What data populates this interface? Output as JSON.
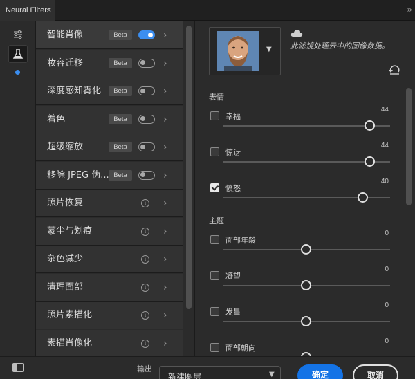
{
  "window": {
    "tab_title": "Neural Filters",
    "tab_close": "×"
  },
  "icons": {
    "sliders": "sliders-icon",
    "flask": "flask-icon",
    "cloud": "cloud-icon",
    "reset": "reset-icon",
    "collapse": "double-chevron-right-icon"
  },
  "colors": {
    "accent": "#1473e6",
    "toggle_on": "#3b8ef0"
  },
  "filters": [
    {
      "label": "智能肖像",
      "badge": "Beta",
      "type": "toggle",
      "on": true,
      "selected": true
    },
    {
      "label": "妆容迁移",
      "badge": "Beta",
      "type": "toggle",
      "on": false
    },
    {
      "label": "深度感知雾化",
      "badge": "Beta",
      "type": "toggle",
      "on": false
    },
    {
      "label": "着色",
      "badge": "Beta",
      "type": "toggle",
      "on": false
    },
    {
      "label": "超级缩放",
      "badge": "Beta",
      "type": "toggle",
      "on": false
    },
    {
      "label": "移除 JPEG 伪...",
      "badge": "Beta",
      "type": "toggle",
      "on": false
    },
    {
      "label": "照片恢复",
      "badge": "",
      "type": "info",
      "info": "i"
    },
    {
      "label": "蒙尘与划痕",
      "badge": "",
      "type": "info",
      "info": "i"
    },
    {
      "label": "杂色减少",
      "badge": "",
      "type": "info",
      "info": "i"
    },
    {
      "label": "清理面部",
      "badge": "",
      "type": "info",
      "info": "i"
    },
    {
      "label": "照片素描化",
      "badge": "",
      "type": "info",
      "info": "i"
    },
    {
      "label": "素描肖像化",
      "badge": "",
      "type": "info",
      "info": "i"
    }
  ],
  "panel": {
    "cloud_text": "此滤镜处理云中的图像数据。",
    "sections": [
      {
        "title": "表情",
        "sliders": [
          {
            "name": "幸福",
            "value": "44",
            "checked": false,
            "level": 0.88
          },
          {
            "name": "惊讶",
            "value": "44",
            "checked": false,
            "level": 0.88
          },
          {
            "name": "愤怒",
            "value": "40",
            "checked": true,
            "level": 0.84
          }
        ]
      },
      {
        "title": "主题",
        "sliders": [
          {
            "name": "面部年龄",
            "value": "0",
            "checked": false,
            "level": 0.5
          },
          {
            "name": "凝望",
            "value": "0",
            "checked": false,
            "level": 0.5
          },
          {
            "name": "发量",
            "value": "0",
            "checked": false,
            "level": 0.5
          },
          {
            "name": "面部朝向",
            "value": "0",
            "checked": false,
            "level": 0.5
          }
        ]
      }
    ]
  },
  "footer": {
    "output_label": "输出",
    "output_value": "新建图层",
    "ok_label": "确定",
    "cancel_label": "取消"
  }
}
